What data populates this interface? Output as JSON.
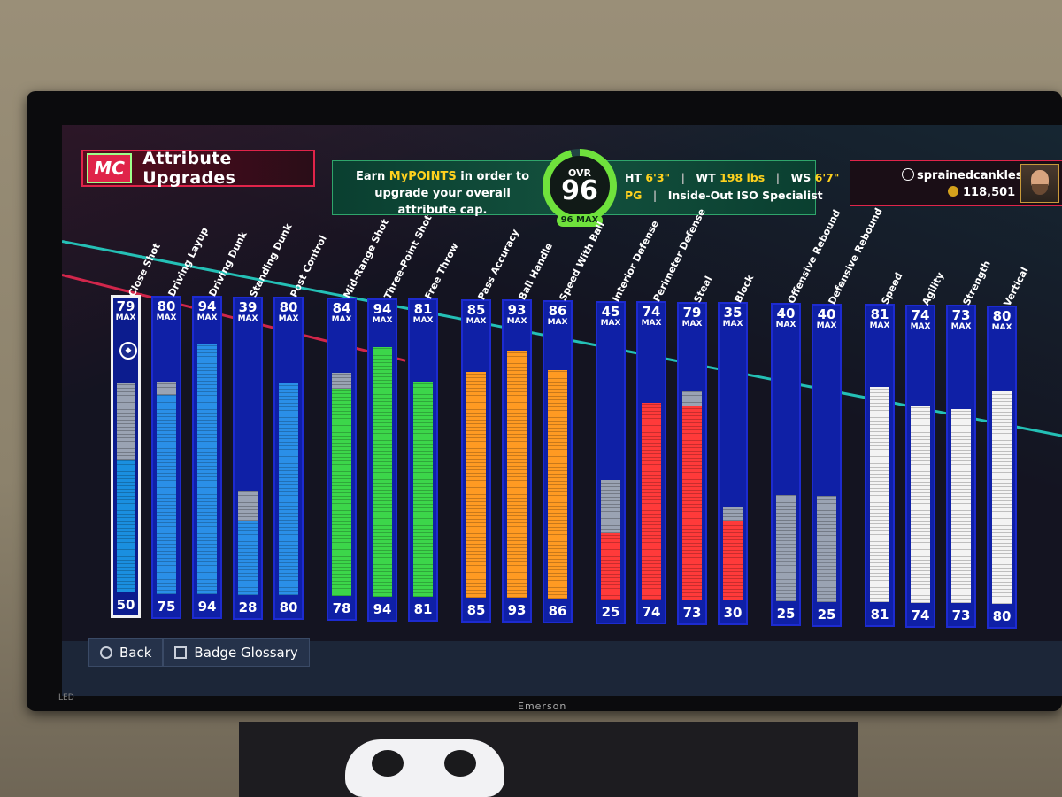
{
  "header": {
    "logo": "MC",
    "title": "Attribute Upgrades"
  },
  "banner": {
    "earn_prefix": "Earn",
    "earn_highlight": "MyPOINTS",
    "earn_suffix": "in order to upgrade your overall attribute cap.",
    "ovr_label": "OVR",
    "ovr_value": "96",
    "ovr_max": "96 MAX",
    "ht_label": "HT",
    "ht_value": "6'3\"",
    "wt_label": "WT",
    "wt_value": "198 lbs",
    "ws_label": "WS",
    "ws_value": "6'7\"",
    "position": "PG",
    "archetype": "Inside-Out ISO Specialist"
  },
  "profile": {
    "username": "sprainedcankles",
    "vc": "118,501"
  },
  "max_label": "MAX",
  "attributes": [
    {
      "name": "Close Shot",
      "max": 79,
      "current": 50,
      "cap": 79,
      "color": "#1a8fe0",
      "selected": true
    },
    {
      "name": "Driving Layup",
      "max": 80,
      "current": 75,
      "cap": 80,
      "color": "#2a8fe8"
    },
    {
      "name": "Driving Dunk",
      "max": 94,
      "current": 94,
      "cap": 94,
      "color": "#2a8fe8"
    },
    {
      "name": "Standing Dunk",
      "max": 39,
      "current": 28,
      "cap": 39,
      "color": "#2a8fe8"
    },
    {
      "name": "Post Control",
      "max": 80,
      "current": 80,
      "cap": 80,
      "color": "#2a8fe8"
    },
    {
      "name": "Mid-Range Shot",
      "max": 84,
      "current": 78,
      "cap": 84,
      "color": "#3cd64a"
    },
    {
      "name": "Three-Point Shot",
      "max": 94,
      "current": 94,
      "cap": 94,
      "color": "#3cd64a"
    },
    {
      "name": "Free Throw",
      "max": 81,
      "current": 81,
      "cap": 81,
      "color": "#3cd64a"
    },
    {
      "name": "Pass Accuracy",
      "max": 85,
      "current": 85,
      "cap": 85,
      "color": "#ff9a22"
    },
    {
      "name": "Ball Handle",
      "max": 93,
      "current": 93,
      "cap": 93,
      "color": "#ff9a22"
    },
    {
      "name": "Speed With Ball",
      "max": 86,
      "current": 86,
      "cap": 86,
      "color": "#ff9a22"
    },
    {
      "name": "Interior Defense",
      "max": 45,
      "current": 25,
      "cap": 45,
      "color": "#ff3a3a"
    },
    {
      "name": "Perimeter Defense",
      "max": 74,
      "current": 74,
      "cap": 74,
      "color": "#ff3a3a"
    },
    {
      "name": "Steal",
      "max": 79,
      "current": 73,
      "cap": 79,
      "color": "#ff3a3a"
    },
    {
      "name": "Block",
      "max": 35,
      "current": 30,
      "cap": 35,
      "color": "#ff3a3a"
    },
    {
      "name": "Offensive Rebound",
      "max": 40,
      "current": 25,
      "cap": 40,
      "color": "#9aa3b3"
    },
    {
      "name": "Defensive Rebound",
      "max": 40,
      "current": 25,
      "cap": 40,
      "color": "#9aa3b3"
    },
    {
      "name": "Speed",
      "max": 81,
      "current": 81,
      "cap": 81,
      "color": "#f3f3f3"
    },
    {
      "name": "Agility",
      "max": 74,
      "current": 74,
      "cap": 74,
      "color": "#f3f3f3"
    },
    {
      "name": "Strength",
      "max": 73,
      "current": 73,
      "cap": 73,
      "color": "#f3f3f3"
    },
    {
      "name": "Vertical",
      "max": 80,
      "current": 80,
      "cap": 80,
      "color": "#f3f3f3"
    }
  ],
  "footer": {
    "back": "Back",
    "glossary": "Badge Glossary"
  },
  "tv": {
    "brand": "Emerson",
    "led": "LED"
  }
}
